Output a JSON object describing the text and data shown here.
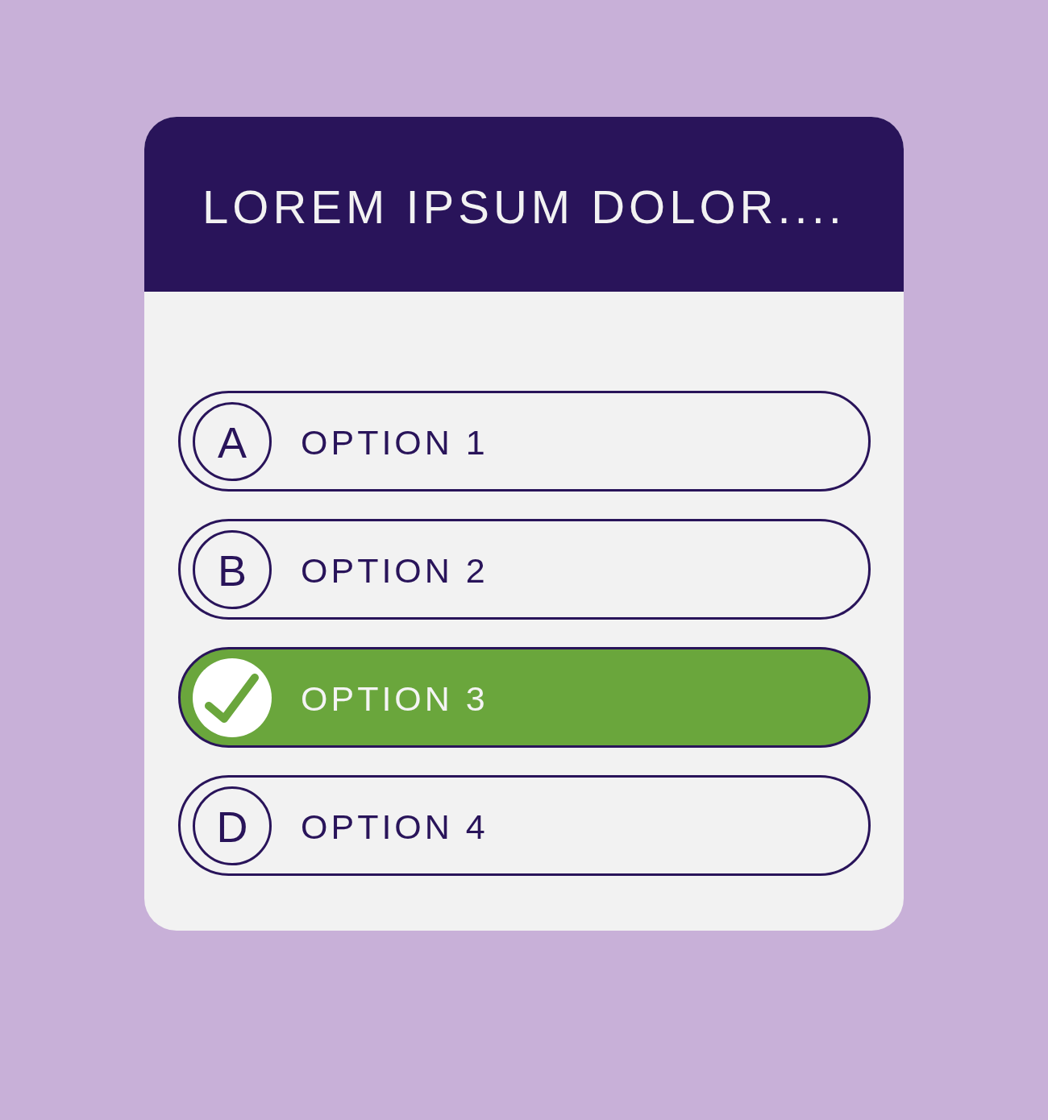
{
  "title": "LOREM IPSUM DOLOR....",
  "options": [
    {
      "letter": "A",
      "label": "OPTION 1",
      "selected": false
    },
    {
      "letter": "B",
      "label": "OPTION 2",
      "selected": false
    },
    {
      "label": "OPTION 3",
      "selected": true
    },
    {
      "letter": "D",
      "label": "OPTION 4",
      "selected": false
    }
  ]
}
